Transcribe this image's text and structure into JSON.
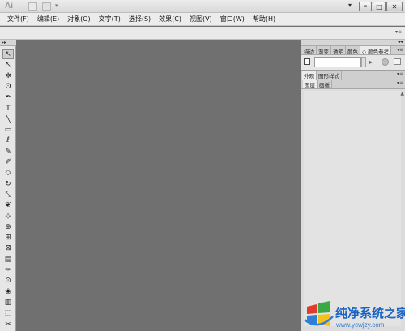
{
  "titlebar": {
    "app_logo": "Ai",
    "window_controls": {
      "minimize": "▬",
      "maximize": "□",
      "close": "✕",
      "workspace_caret": "▾"
    }
  },
  "menubar": {
    "items": [
      {
        "label": "文件(F)"
      },
      {
        "label": "编辑(E)"
      },
      {
        "label": "对象(O)"
      },
      {
        "label": "文字(T)"
      },
      {
        "label": "选择(S)"
      },
      {
        "label": "效果(C)"
      },
      {
        "label": "视图(V)"
      },
      {
        "label": "窗口(W)"
      },
      {
        "label": "帮助(H)"
      }
    ]
  },
  "tools": {
    "header_arrows": "▸▸",
    "items": [
      {
        "name": "selection-tool-icon",
        "glyph": "↖"
      },
      {
        "name": "direct-selection-tool-icon",
        "glyph": "↖"
      },
      {
        "name": "magic-wand-tool-icon",
        "glyph": "✲"
      },
      {
        "name": "lasso-tool-icon",
        "glyph": "ʘ"
      },
      {
        "name": "pen-tool-icon",
        "glyph": "✒"
      },
      {
        "name": "type-tool-icon",
        "glyph": "T"
      },
      {
        "name": "line-tool-icon",
        "glyph": "╲"
      },
      {
        "name": "rectangle-tool-icon",
        "glyph": "▭"
      },
      {
        "name": "paintbrush-tool-icon",
        "glyph": "ℓ"
      },
      {
        "name": "pencil-tool-icon",
        "glyph": "✎"
      },
      {
        "name": "blob-brush-tool-icon",
        "glyph": "✐"
      },
      {
        "name": "eraser-tool-icon",
        "glyph": "◇"
      },
      {
        "name": "rotate-tool-icon",
        "glyph": "↻"
      },
      {
        "name": "scale-tool-icon",
        "glyph": "⤡"
      },
      {
        "name": "warp-tool-icon",
        "glyph": "❦"
      },
      {
        "name": "free-transform-tool-icon",
        "glyph": "⊹"
      },
      {
        "name": "shape-builder-tool-icon",
        "glyph": "⊕"
      },
      {
        "name": "perspective-grid-tool-icon",
        "glyph": "⊞"
      },
      {
        "name": "mesh-tool-icon",
        "glyph": "⊠"
      },
      {
        "name": "gradient-tool-icon",
        "glyph": "▤"
      },
      {
        "name": "eyedropper-tool-icon",
        "glyph": "✑"
      },
      {
        "name": "blend-tool-icon",
        "glyph": "⊙"
      },
      {
        "name": "symbol-sprayer-tool-icon",
        "glyph": "❀"
      },
      {
        "name": "column-graph-tool-icon",
        "glyph": "▥"
      },
      {
        "name": "artboard-tool-icon",
        "glyph": "⬚"
      },
      {
        "name": "slice-tool-icon",
        "glyph": "✂"
      }
    ]
  },
  "panels": {
    "header_arrows": "◂◂",
    "color_panel": {
      "tabs": [
        {
          "label": "描边",
          "active": false
        },
        {
          "label": "渐变",
          "active": false
        },
        {
          "label": "透明",
          "active": false
        },
        {
          "label": "颜色",
          "active": false
        },
        {
          "label": "◇ 颜色参考",
          "active": true
        }
      ],
      "close_glyph": "▾≡",
      "field_value": ""
    },
    "appearance_panel": {
      "tabs": [
        {
          "label": "外观",
          "active": true
        },
        {
          "label": "图形样式",
          "active": false
        }
      ],
      "close_glyph": "▾≡"
    },
    "layers_panel": {
      "tabs": [
        {
          "label": "图层",
          "active": true
        },
        {
          "label": "画板",
          "active": false
        }
      ],
      "close_glyph": "▾≡",
      "scroll_up": "▲"
    }
  },
  "watermark": {
    "title": "纯净系统之家",
    "url": "www.ycwjzy.com",
    "colors": {
      "primary": "#1a62c4",
      "accent_red": "#e23b2e",
      "accent_yellow": "#f5c118",
      "accent_green": "#3aa845",
      "accent_blue": "#2f7fd8"
    }
  },
  "theme": {
    "canvas_bg": "#707070",
    "chrome_bg": "#e6e6e6"
  }
}
